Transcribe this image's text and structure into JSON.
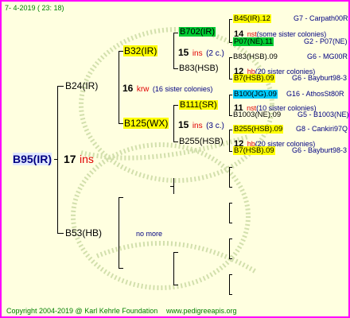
{
  "header": {
    "date": "7-  4-2019  ( 23: 18)"
  },
  "footer": {
    "copyright": "Copyright 2004-2019 @ Karl Kehrle Foundation",
    "url": "www.pedigreeapis.org"
  },
  "root": {
    "name": "B95(IR)",
    "num": "17",
    "tag": "ins"
  },
  "gen1": {
    "sire": "B24(IR)",
    "dam": "B53(HB)",
    "dam_note": "no more",
    "mid": {
      "num": "16",
      "tag": "krw",
      "note": "(16 sister colonies)"
    }
  },
  "gen2": {
    "a": {
      "name": "B32(IR)",
      "num": "15",
      "tag": "ins",
      "note": "(2 c.)"
    },
    "b": {
      "name": "B125(WX)",
      "num": "15",
      "tag": "ins",
      "note": "(3 c.)"
    }
  },
  "gen3": {
    "a1": "B702(IR)",
    "a2": "B83(HSB)",
    "b1": "B111(SR)",
    "b2": "B255(HSB)",
    "n1": {
      "num": "14",
      "tag": "nst",
      "note": "(some sister colonies)"
    },
    "n2": {
      "num": "12",
      "tag": "hb",
      "note": "(20 sister colonies)"
    },
    "n3": {
      "num": "11",
      "tag": "nst",
      "note": "(10 sister colonies)"
    },
    "n4": {
      "num": "12",
      "tag": "hb",
      "note": "(20 sister colonies)"
    }
  },
  "gen4": [
    {
      "name": "B45(IR).12",
      "origin": "G7 - Carpath00R",
      "hl": "yellow"
    },
    {
      "name": "P07(NE).11",
      "origin": "G2 - P07(NE)",
      "hl": "green"
    },
    {
      "name": "B83(HSB).09",
      "origin": "G6 - MG00R",
      "hl": "none"
    },
    {
      "name": "B7(HSB).09",
      "origin": "G6 - Bayburt98-3",
      "hl": "yellow"
    },
    {
      "name": "B100(JG).09",
      "origin": "G16 - AthosSt80R",
      "hl": "cyan"
    },
    {
      "name": "B1003(NE).09",
      "origin": "G5 - B1003(NE)",
      "hl": "none"
    },
    {
      "name": "B255(HSB).09",
      "origin": "G8 - Cankiri97Q",
      "hl": "yellow"
    },
    {
      "name": "B7(HSB).09",
      "origin": "G6 - Bayburt98-3",
      "hl": "yellow"
    }
  ]
}
